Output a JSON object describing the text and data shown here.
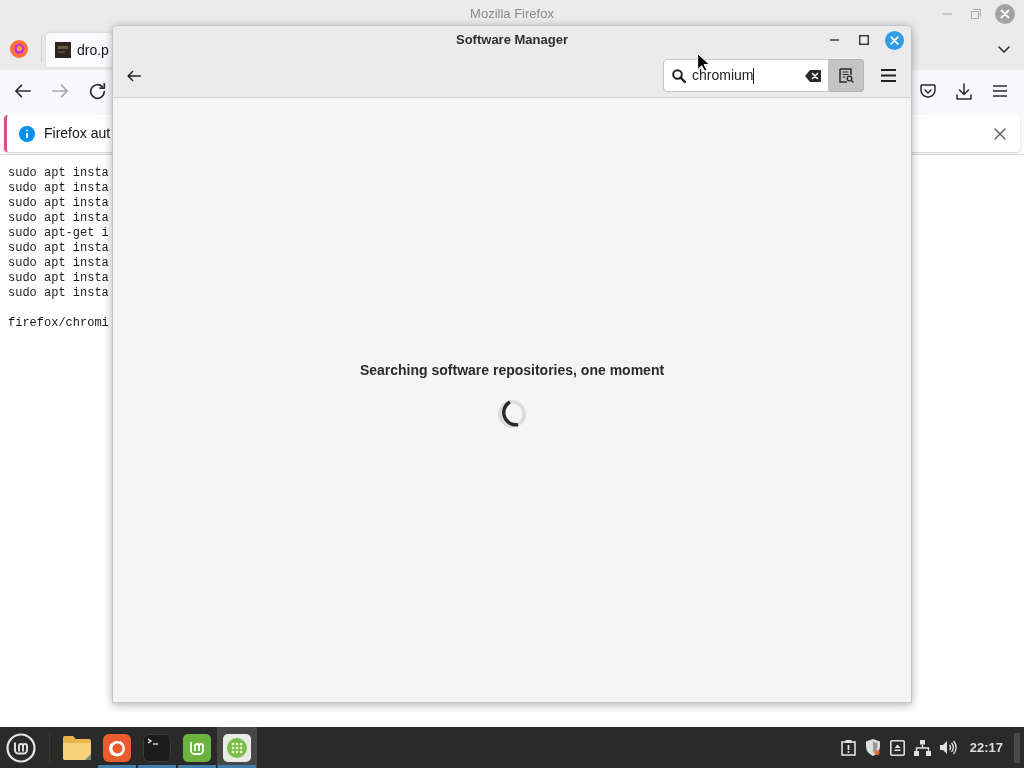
{
  "firefox": {
    "title": "Mozilla Firefox",
    "tabs": [
      {
        "title": "dro.p",
        "selected": true
      }
    ],
    "nav_buttons": [
      {
        "kind": "back",
        "disabled": false
      },
      {
        "kind": "forward",
        "disabled": true
      },
      {
        "kind": "reload",
        "disabled": false
      }
    ],
    "notification": {
      "text": "Firefox aut"
    },
    "page_blocks": [
      {
        "lines": [
          "sudo apt insta",
          "sudo apt insta",
          "sudo apt insta",
          "sudo apt insta",
          "sudo apt-get i",
          "sudo apt insta",
          "sudo apt insta",
          "sudo apt insta",
          "sudo apt insta"
        ]
      },
      {
        "lines": [
          "firefox/chromi"
        ]
      }
    ]
  },
  "software_manager": {
    "title": "Software Manager",
    "search": {
      "value": "chromium"
    },
    "search_toggle": {
      "on": true
    },
    "status": "Searching software repositories, one moment"
  },
  "taskbar": {
    "launchers": [
      {
        "kind": "files",
        "running": false,
        "selected": false
      },
      {
        "kind": "browser",
        "running": true,
        "selected": false
      },
      {
        "kind": "terminal",
        "running": true,
        "selected": false
      },
      {
        "kind": "update",
        "running": true,
        "selected": false
      },
      {
        "kind": "software",
        "running": true,
        "selected": true
      }
    ],
    "clock": "22:17"
  }
}
